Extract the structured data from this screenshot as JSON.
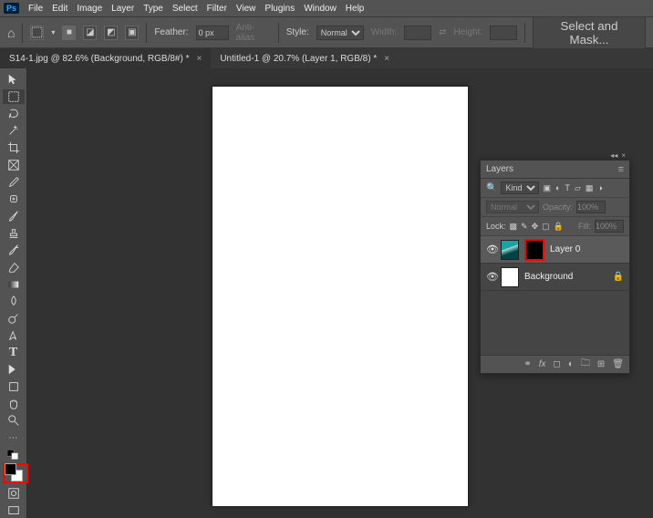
{
  "menu": {
    "items": [
      "File",
      "Edit",
      "Image",
      "Layer",
      "Type",
      "Select",
      "Filter",
      "View",
      "Plugins",
      "Window",
      "Help"
    ]
  },
  "options": {
    "feather_label": "Feather:",
    "feather_value": "0 px",
    "antialias": "Anti-alias",
    "style_label": "Style:",
    "style_value": "Normal",
    "width_label": "Width:",
    "height_label": "Height:",
    "select_mask": "Select and Mask..."
  },
  "tabs": [
    {
      "label": "S14-1.jpg @ 82.6% (Background, RGB/8#) *",
      "active": true
    },
    {
      "label": "Untitled-1 @ 20.7% (Layer 1, RGB/8) *",
      "active": false
    }
  ],
  "toolbox": {
    "tools": [
      "move",
      "marquee",
      "lasso",
      "wand",
      "crop",
      "frame",
      "eyedropper",
      "heal",
      "brush",
      "stamp",
      "history",
      "eraser",
      "gradient",
      "blur",
      "dodge",
      "pen",
      "type",
      "path",
      "rect",
      "hand",
      "zoom"
    ],
    "fg_color": "#000000",
    "bg_color": "#ffffff"
  },
  "layers_panel": {
    "title": "Layers",
    "kind_label": "Kind",
    "blend_mode": "Normal",
    "opacity_label": "Opacity:",
    "opacity_value": "100%",
    "lock_label": "Lock:",
    "fill_label": "Fill:",
    "fill_value": "100%",
    "layers": [
      {
        "name": "Layer 0",
        "selected": true,
        "has_mask": true,
        "thumb": "img"
      },
      {
        "name": "Background",
        "selected": false,
        "locked": true,
        "thumb": "white"
      }
    ],
    "foot_icons": [
      "link",
      "fx",
      "mask",
      "adjust",
      "group",
      "new",
      "trash"
    ]
  }
}
